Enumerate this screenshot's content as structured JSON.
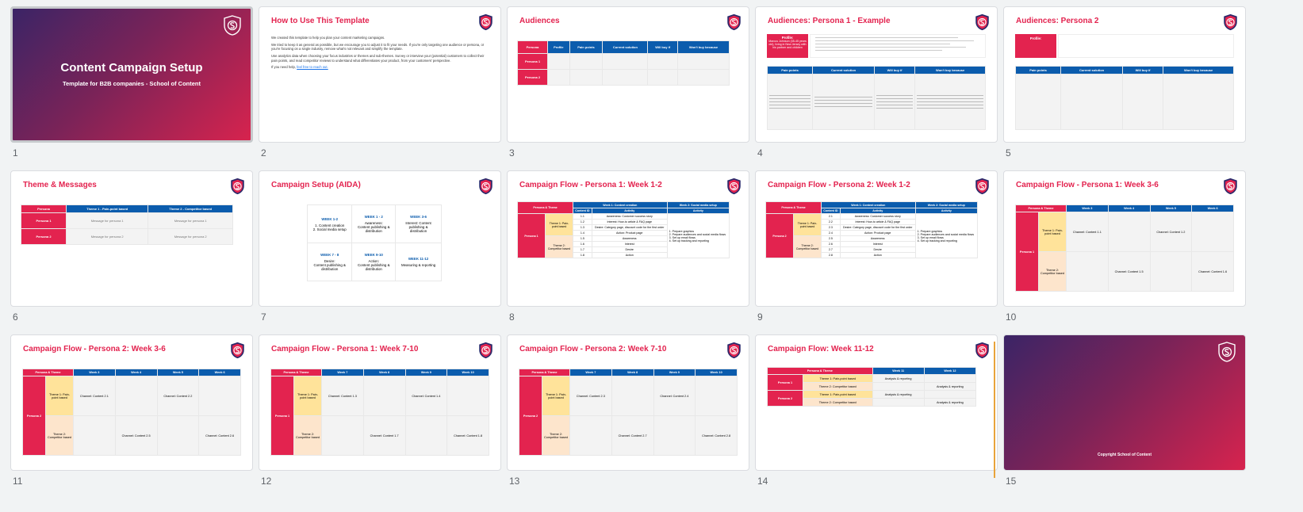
{
  "slides": [
    {
      "num": "1",
      "title": "Content Campaign Setup",
      "subtitle": "Template for B2B companies - School of Content"
    },
    {
      "num": "2",
      "title": "How to Use This Template",
      "p1": "We created this template to help you plan your content marketing campaigns.",
      "p2": "We tried to keep it as general as possible, but we encourage you to adjust it to fit your needs. If you're only targeting one audience or persona, or you're focusing on a single industry, remove what's not relevant and simplify the template.",
      "p3": "Use analytics data when choosing your focus industries or themes and sub-themes. Survey or interview your (potential) customers to collect their pain points, and read competitor reviews to understand what differentiates your product, from your customers' perspective.",
      "p4_prefix": "If you need help, ",
      "p4_link": "feel free to reach out."
    },
    {
      "num": "3",
      "title": "Audiences",
      "headers": [
        "Persona",
        "Profile",
        "Pain points",
        "Current solution",
        "Will buy if",
        "Won't buy because"
      ],
      "rows": [
        "Persona 1",
        "Persona 2"
      ]
    },
    {
      "num": "4",
      "title": "Audiences: Persona 1 - Example",
      "profile_label": "Profile:",
      "profile_sub": "Marcus Johnson (35-45 years old), living in New Jersey with his partner and children",
      "headers": [
        "Pain points",
        "Current solution",
        "Will buy if",
        "Won't buy because"
      ]
    },
    {
      "num": "5",
      "title": "Audiences: Persona 2",
      "profile_label": "Profile:",
      "headers": [
        "Pain points",
        "Current solution",
        "Will buy if",
        "Won't buy because"
      ]
    },
    {
      "num": "6",
      "title": "Theme & Messages",
      "headers": [
        "Persona",
        "Theme 1 - Pain-point based",
        "Theme 2 - Competitor based"
      ],
      "rows": [
        {
          "persona": "Persona 1",
          "t1": "Message for persona 1",
          "t2": "Message for persona 1"
        },
        {
          "persona": "Persona 2",
          "t1": "Message for persona 2",
          "t2": "Message for persona 2"
        }
      ]
    },
    {
      "num": "7",
      "title": "Campaign Setup (AIDA)",
      "cells": [
        {
          "week": "WEEK 1-2",
          "lines": [
            "1. Content creation",
            "2. Social media setup"
          ]
        },
        {
          "week": "WEEK 1 - 2",
          "lines": [
            "Awareness:",
            "Content publishing &",
            "distribution"
          ]
        },
        {
          "week": "WEEK 3-6",
          "lines": [
            "Interest: Content",
            "publishing &",
            "distribution"
          ]
        },
        {
          "week": "WEEK 7 - 8",
          "lines": [
            "Desire:",
            "Content publishing &",
            "distribution"
          ]
        },
        {
          "week": "WEEK 9-10",
          "lines": [
            "Action:",
            "Content publishing &",
            "distribution"
          ]
        },
        {
          "week": "WEEK 11-12",
          "lines": [
            "Measuring & reporting"
          ]
        }
      ]
    },
    {
      "num": "8",
      "title": "Campaign Flow - Persona 1: Week 1-2",
      "h_pt": "Persona & Theme",
      "h_w1": "Week 1: Content creation",
      "h_w2": "Week 2: Social media setup",
      "h_cid": "Content ID",
      "h_act": "Activity",
      "persona": "Persona 1",
      "theme1": "Theme 1: Pain-point based",
      "theme2": "Theme 2: Competitor based",
      "ids": [
        "1.1",
        "1.2",
        "1.3",
        "1.4",
        "1.5",
        "1.6",
        "1.7",
        "1.8"
      ],
      "acts": [
        "Awareness: Customer success story",
        "Interest: How-to article & FAQ page",
        "Desire: Category page, discount code for the first order",
        "Action: Product page",
        "Awareness",
        "Interest",
        "Desire",
        "Action"
      ],
      "w2": [
        "1. Prepare graphics",
        "2. Prepare audiences and social media flows",
        "3. Set up email flows",
        "4. Set up tracking and reporting"
      ]
    },
    {
      "num": "9",
      "title": "Campaign Flow - Persona 2: Week 1-2",
      "persona": "Persona 2",
      "ids": [
        "2.1",
        "2.2",
        "2.3",
        "2.4",
        "2.5",
        "2.6",
        "2.7",
        "2.8"
      ]
    },
    {
      "num": "10",
      "title": "Campaign Flow - Persona 1: Week 3-6",
      "weeks": [
        "Week 3",
        "Week 4",
        "Week 5",
        "Week 6"
      ],
      "cells": [
        "Channel: Content 1.1",
        "Channel: Content 1.2",
        "Channel: Content 1.5",
        "Channel: Content 1.6"
      ]
    },
    {
      "num": "11",
      "title": "Campaign Flow - Persona 2: Week 3-6",
      "weeks": [
        "Week 3",
        "Week 4",
        "Week 5",
        "Week 6"
      ],
      "cells": [
        "Channel: Content 2.1",
        "Channel: Content 2.2",
        "Channel: Content 2.5",
        "Channel: Content 2.6"
      ]
    },
    {
      "num": "12",
      "title": "Campaign Flow - Persona 1: Week 7-10",
      "weeks": [
        "Week 7",
        "Week 8",
        "Week 9",
        "Week 10"
      ],
      "cells": [
        "Channel: Content 1.3",
        "Channel: Content 1.4",
        "Channel: Content 1.7",
        "Channel: Content 1.8"
      ]
    },
    {
      "num": "13",
      "title": "Campaign Flow - Persona 2: Week 7-10",
      "weeks": [
        "Week 7",
        "Week 8",
        "Week 9",
        "Week 10"
      ],
      "cells": [
        "Channel: Content 2.3",
        "Channel: Content 2.4",
        "Channel: Content 2.7",
        "Channel: Content 2.8"
      ]
    },
    {
      "num": "14",
      "title": "Campaign Flow: Week 11-12",
      "weeks": [
        "Week 11",
        "Week 12"
      ],
      "rows": [
        {
          "persona": "Persona 1",
          "theme": "Theme 1: Pain-point based",
          "w11": "Analysis & reporting",
          "w12": ""
        },
        {
          "persona": "",
          "theme": "Theme 2: Competitor based",
          "w11": "",
          "w12": "Analysis & reporting"
        },
        {
          "persona": "Persona 2",
          "theme": "Theme 1: Pain-point based",
          "w11": "Analysis & reporting",
          "w12": ""
        },
        {
          "persona": "",
          "theme": "Theme 2: Competitor based",
          "w11": "",
          "w12": "Analysis & reporting"
        }
      ]
    },
    {
      "num": "15",
      "copyright": "Copyright School of Content"
    }
  ],
  "colors": {
    "accent": "#e3234f",
    "header_blue": "#0b5cad",
    "theme1": "#ffe39a",
    "theme2": "#fde5cc",
    "insert_cursor": "#e8a33a"
  }
}
